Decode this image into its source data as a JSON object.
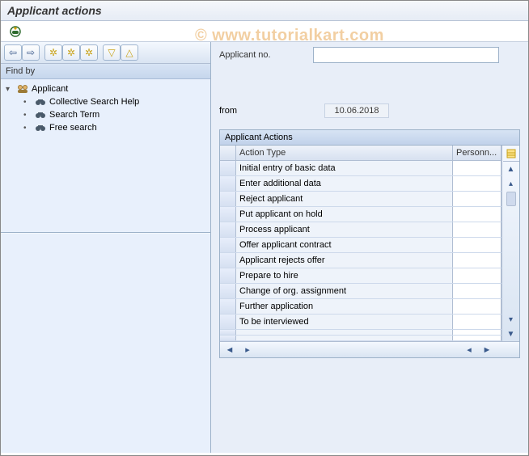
{
  "header": {
    "title": "Applicant actions"
  },
  "watermark": "©  www.tutorialkart.com",
  "left": {
    "findby_label": "Find by",
    "tree": {
      "root_label": "Applicant",
      "items": [
        {
          "label": "Collective Search Help"
        },
        {
          "label": "Search Term"
        },
        {
          "label": "Free search"
        }
      ]
    },
    "toolbar": {
      "back_icon": "⬅",
      "fwd_icon": "➡",
      "btn3_icon": "✶",
      "btn4_icon": "✶",
      "btn5_icon": "✶",
      "expand_icon": "▽",
      "collapse_icon": "△"
    }
  },
  "right": {
    "applicant_label": "Applicant no.",
    "applicant_value": "",
    "from_label": "from",
    "from_value": "10.06.2018",
    "panel_title": "Applicant Actions",
    "columns": {
      "action": "Action Type",
      "personn": "Personn..."
    },
    "rows": [
      {
        "action": "Initial entry of basic data",
        "personn": ""
      },
      {
        "action": "Enter additional data",
        "personn": ""
      },
      {
        "action": "Reject applicant",
        "personn": ""
      },
      {
        "action": "Put applicant on hold",
        "personn": ""
      },
      {
        "action": "Process applicant",
        "personn": ""
      },
      {
        "action": "Offer applicant contract",
        "personn": ""
      },
      {
        "action": "Applicant rejects offer",
        "personn": ""
      },
      {
        "action": "Prepare to hire",
        "personn": ""
      },
      {
        "action": "Change of org. assignment",
        "personn": ""
      },
      {
        "action": "Further application",
        "personn": ""
      },
      {
        "action": "To be interviewed",
        "personn": ""
      },
      {
        "action": "",
        "personn": ""
      },
      {
        "action": "",
        "personn": ""
      }
    ]
  },
  "chart_data": {
    "type": "table",
    "title": "Applicant Actions",
    "columns": [
      "Action Type",
      "Personn..."
    ],
    "rows": [
      [
        "Initial entry of basic data",
        ""
      ],
      [
        "Enter additional data",
        ""
      ],
      [
        "Reject applicant",
        ""
      ],
      [
        "Put applicant on hold",
        ""
      ],
      [
        "Process applicant",
        ""
      ],
      [
        "Offer applicant contract",
        ""
      ],
      [
        "Applicant rejects offer",
        ""
      ],
      [
        "Prepare to hire",
        ""
      ],
      [
        "Change of org. assignment",
        ""
      ],
      [
        "Further application",
        ""
      ],
      [
        "To be interviewed",
        ""
      ]
    ]
  }
}
